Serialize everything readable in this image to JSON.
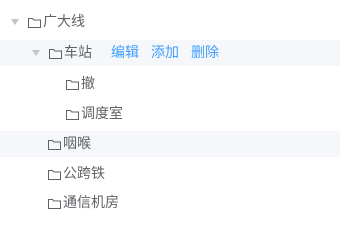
{
  "tree": {
    "root": {
      "label": "广大线"
    },
    "station": {
      "label": "车站",
      "actions": {
        "edit": "编辑",
        "add": "添加",
        "delete": "删除"
      },
      "children": [
        {
          "label": "撤"
        },
        {
          "label": "调度室"
        }
      ]
    },
    "siblings": [
      {
        "label": "咽喉"
      },
      {
        "label": "公跨铁"
      },
      {
        "label": "通信机房"
      }
    ]
  },
  "colors": {
    "action": "#409eff",
    "highlight": "#f5f7fa",
    "caret": "#c0c4cc",
    "text": "#606266"
  }
}
